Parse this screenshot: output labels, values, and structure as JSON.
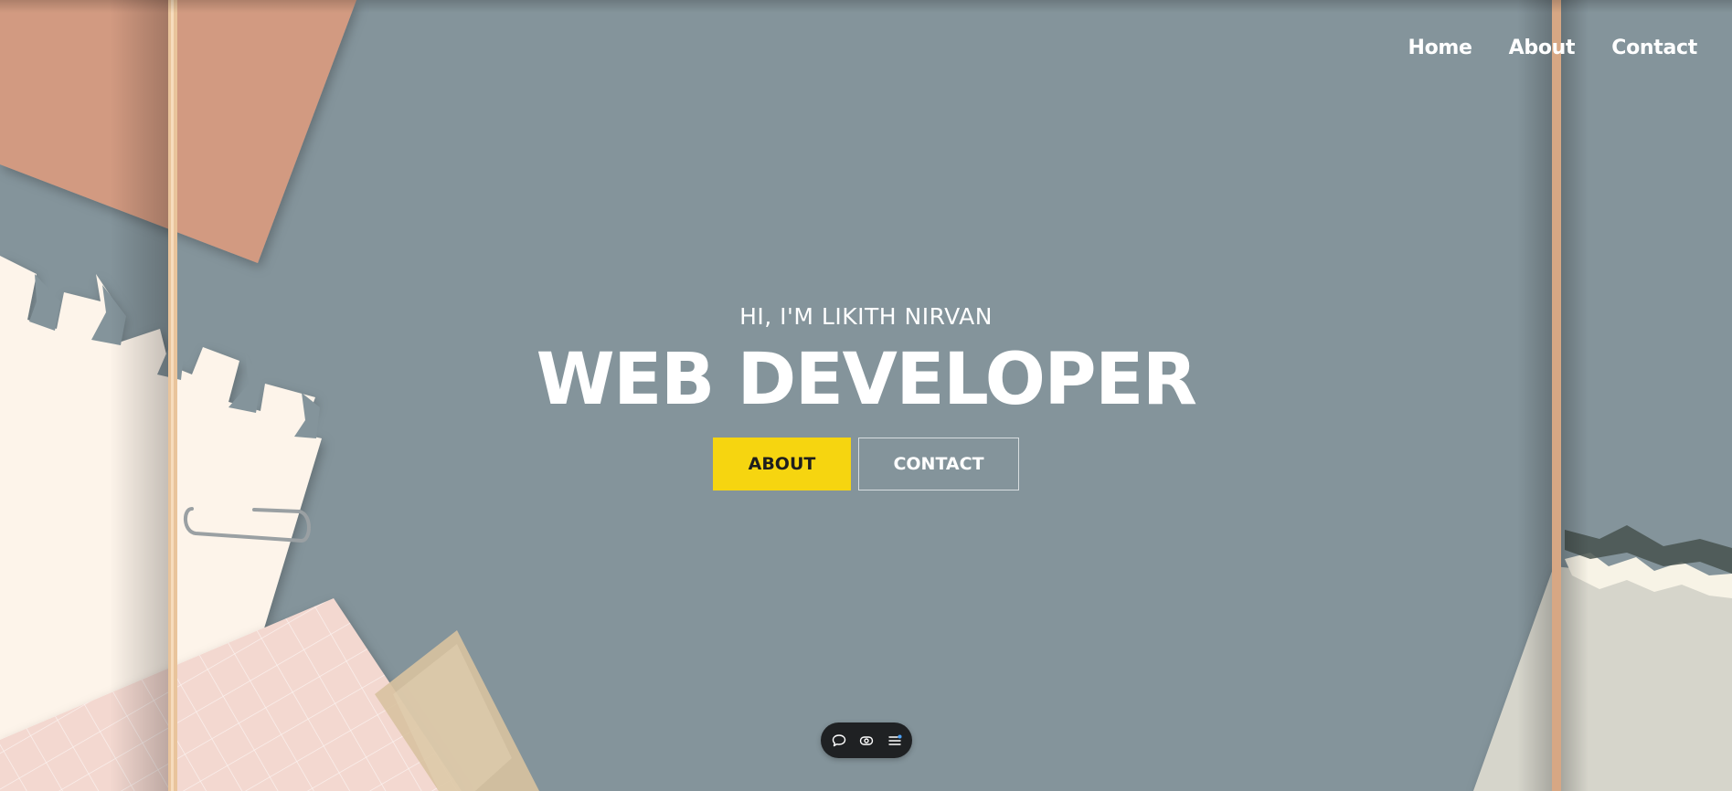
{
  "nav": {
    "items": [
      {
        "label": "Home"
      },
      {
        "label": "About"
      },
      {
        "label": "Contact"
      }
    ]
  },
  "hero": {
    "subtitle": "HI, I'M LIKITH NIRVAN",
    "title": "WEB DEVELOPER",
    "buttons": {
      "about": "ABOUT",
      "contact": "CONTACT"
    }
  },
  "dock": {
    "icons": [
      "chat-icon",
      "eye-icon",
      "menu-icon"
    ]
  },
  "colors": {
    "background": "#84949b",
    "accent": "#f6d510",
    "paper_cream": "#fdf4ea",
    "paper_peach": "#d69f86",
    "paper_pink": "#f3d8d0",
    "tape": "#d8c2a0",
    "dock": "#1f2123"
  }
}
